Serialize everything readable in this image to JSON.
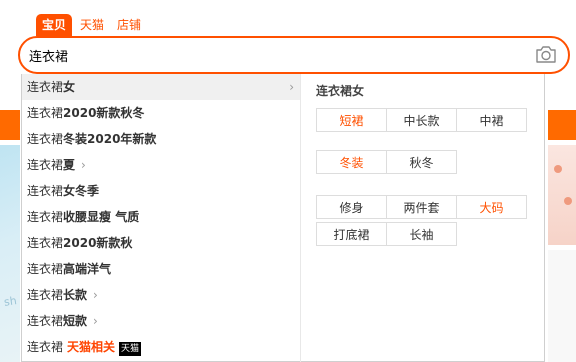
{
  "tabs": [
    "宝贝",
    "天猫",
    "店铺"
  ],
  "search": {
    "value": "连衣裙"
  },
  "suggestions": [
    {
      "prefix": "连衣裙",
      "rest": "女",
      "chevron": true
    },
    {
      "prefix": "连衣裙",
      "rest": "2020新款秋冬",
      "chevron": false
    },
    {
      "prefix": "连衣裙",
      "rest": "冬装2020年新款",
      "chevron": false
    },
    {
      "prefix": "连衣裙",
      "rest": "夏",
      "chevron": true
    },
    {
      "prefix": "连衣裙",
      "rest": "女冬季",
      "chevron": false
    },
    {
      "prefix": "连衣裙",
      "rest": "收腰显瘦 气质",
      "chevron": false
    },
    {
      "prefix": "连衣裙",
      "rest": "2020新款秋",
      "chevron": false
    },
    {
      "prefix": "连衣裙",
      "rest": "高端洋气",
      "chevron": false
    },
    {
      "prefix": "连衣裙",
      "rest": "长款",
      "chevron": true
    },
    {
      "prefix": "连衣裙",
      "rest": "短款",
      "chevron": true
    }
  ],
  "tmall_row": {
    "prefix": "连衣裙",
    "label": "天猫相关",
    "icon_text": "天猫"
  },
  "panel": {
    "title": "连衣裙女",
    "groups": [
      [
        "短裙",
        "中长款",
        "中裙"
      ],
      [
        "冬装",
        "秋冬"
      ],
      [
        "修身",
        "两件套",
        "大码",
        "打底裙",
        "长袖"
      ]
    ],
    "highlighted": [
      "短裙",
      "冬装",
      "大码"
    ]
  },
  "colors": {
    "accent": "#ff5000",
    "tmall_red": "#ff4400"
  },
  "icons": {
    "camera": "camera-icon",
    "chevron": "chevron-right-icon",
    "tmall": "tmall-cat-icon"
  }
}
